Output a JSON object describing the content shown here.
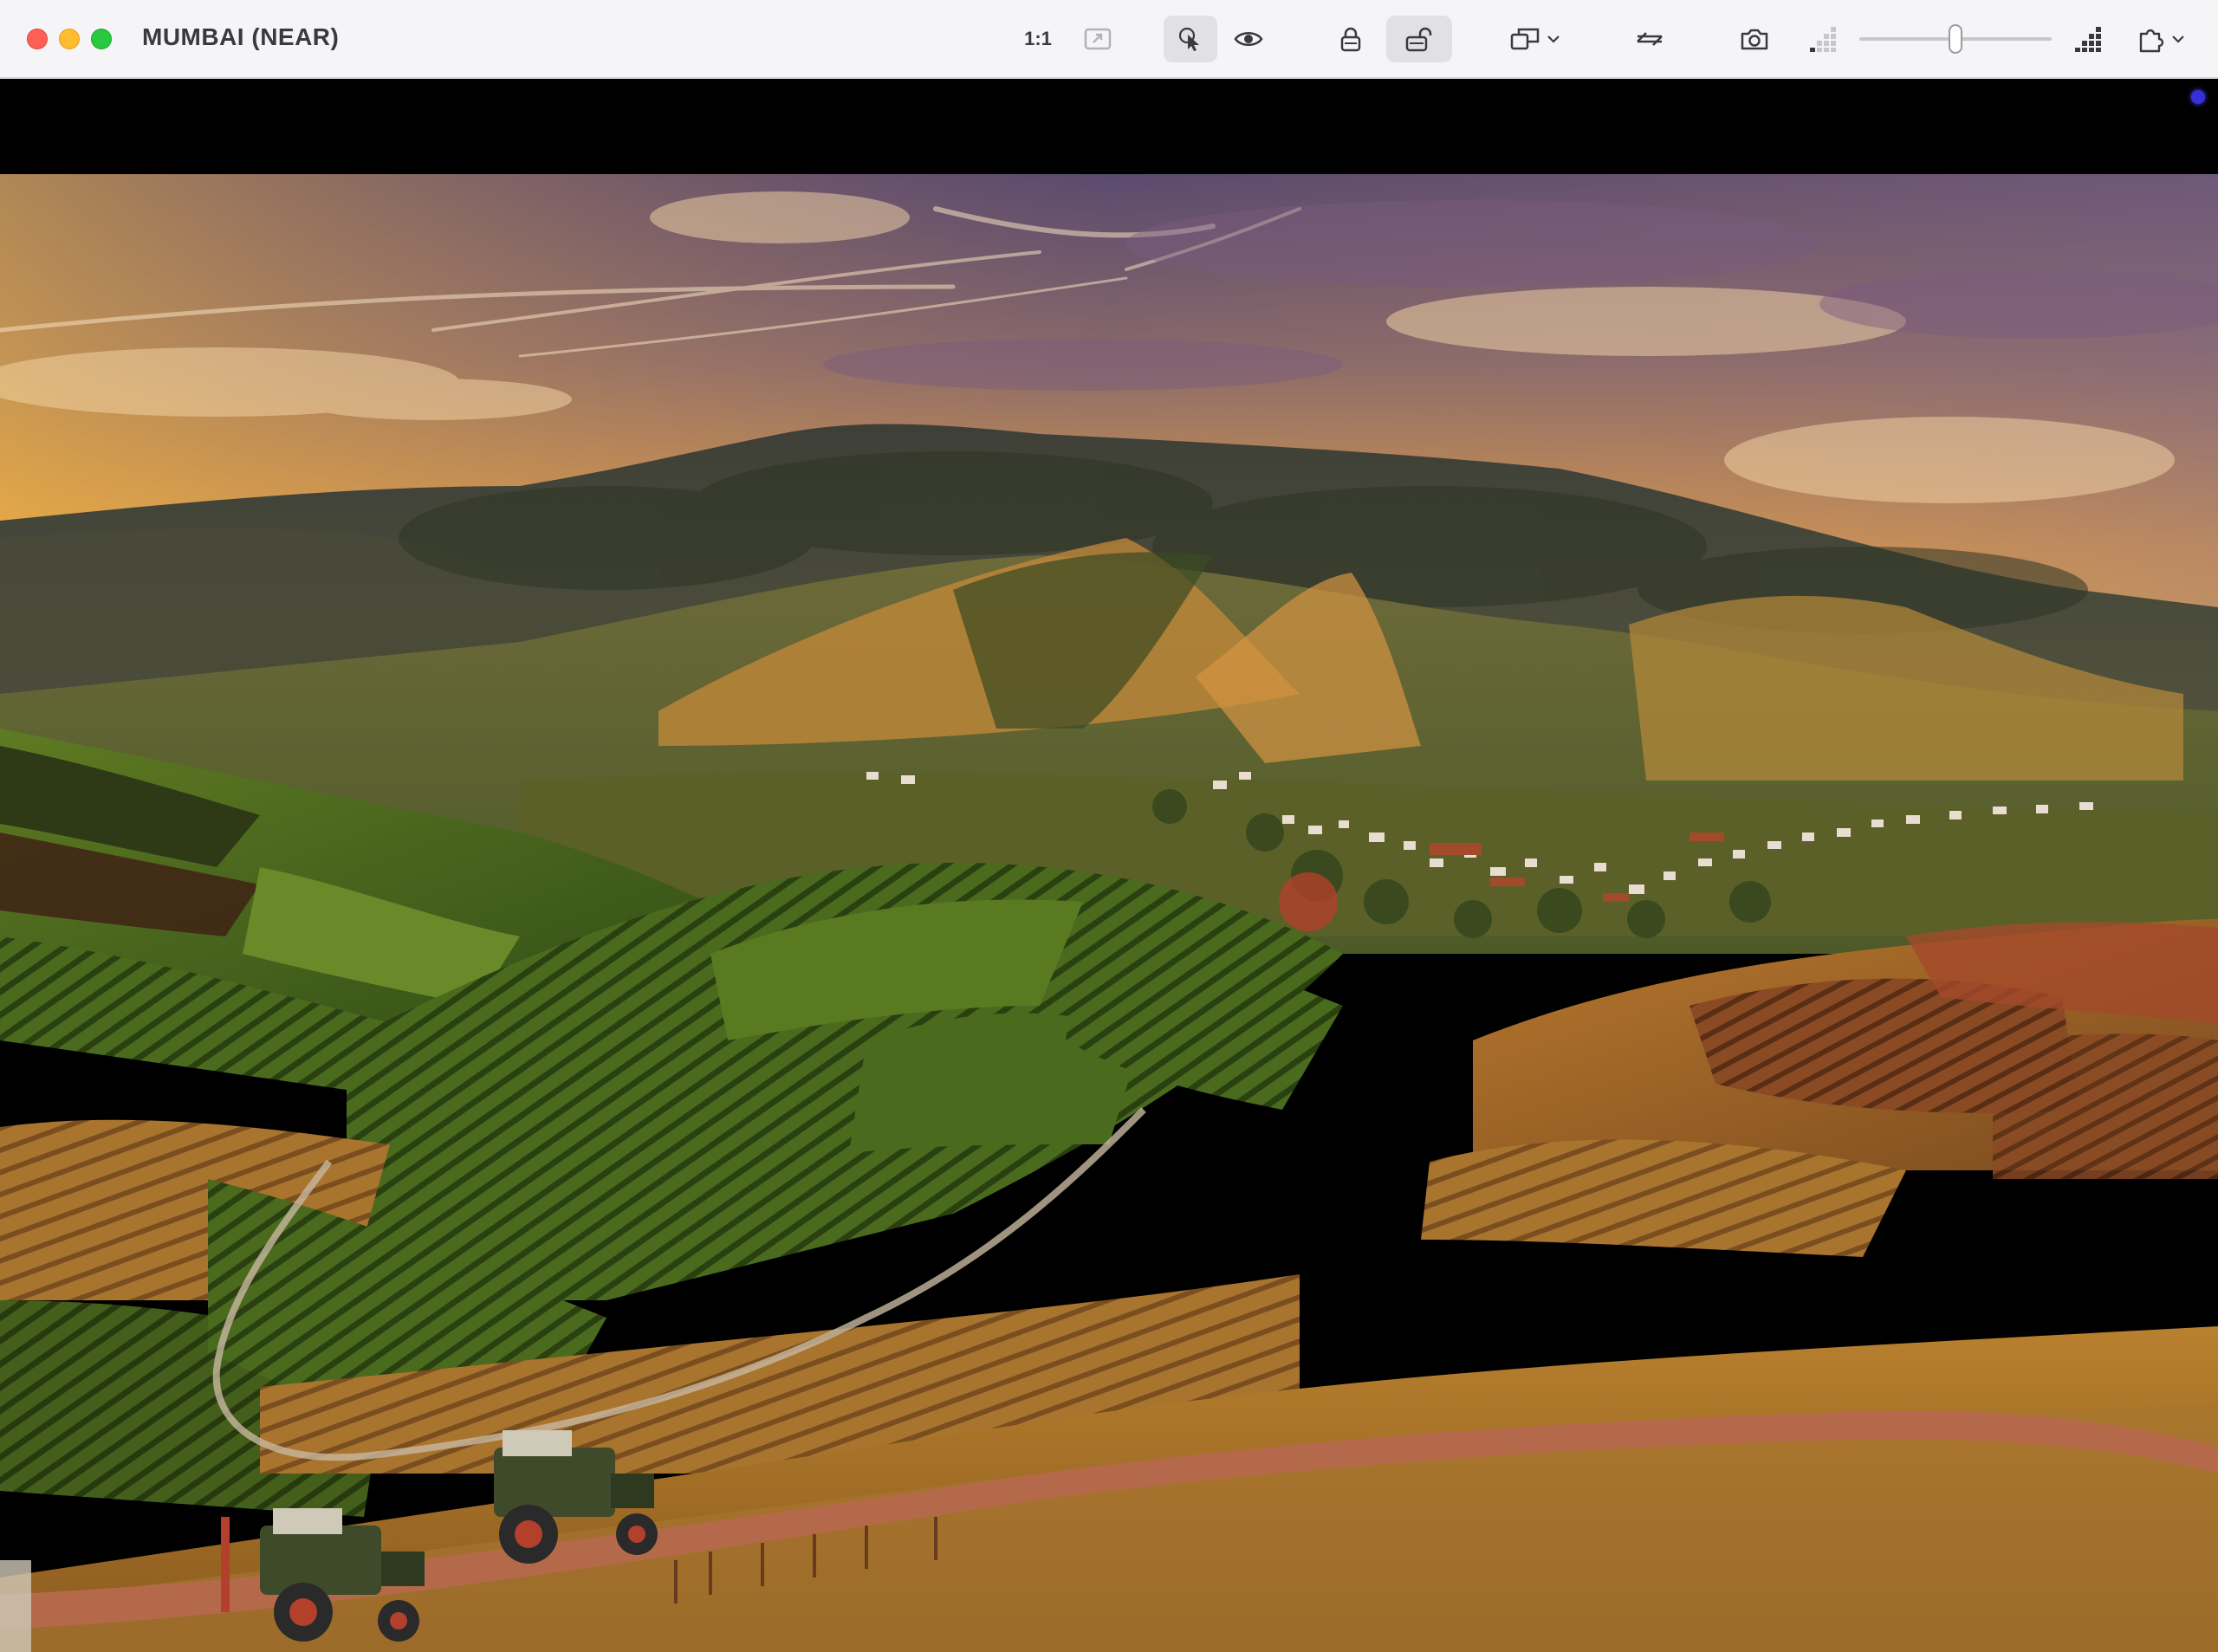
{
  "window": {
    "title": "MUMBAI (NEAR)"
  },
  "toolbar": {
    "ratio_label": "1:1",
    "zoom": {
      "level": 0.5
    }
  },
  "icons": {
    "ratio": "actual-size-icon",
    "fit": "fit-window-icon",
    "pointer": "cursor-icon",
    "eye": "eye-icon",
    "lock": "lock-icon",
    "unlock": "unlock-icon",
    "window": "window-layout-icon",
    "swap": "swap-icon",
    "camera": "camera-icon",
    "quality_low": "quality-low-icon",
    "quality_high": "quality-high-icon",
    "extensions": "puzzle-icon"
  },
  "colors": {
    "toolbar_bg": "#f5f5f7",
    "close": "#fe5f57",
    "minimize": "#febc2e",
    "maximize": "#28c840",
    "status_dot": "#3530d8"
  }
}
